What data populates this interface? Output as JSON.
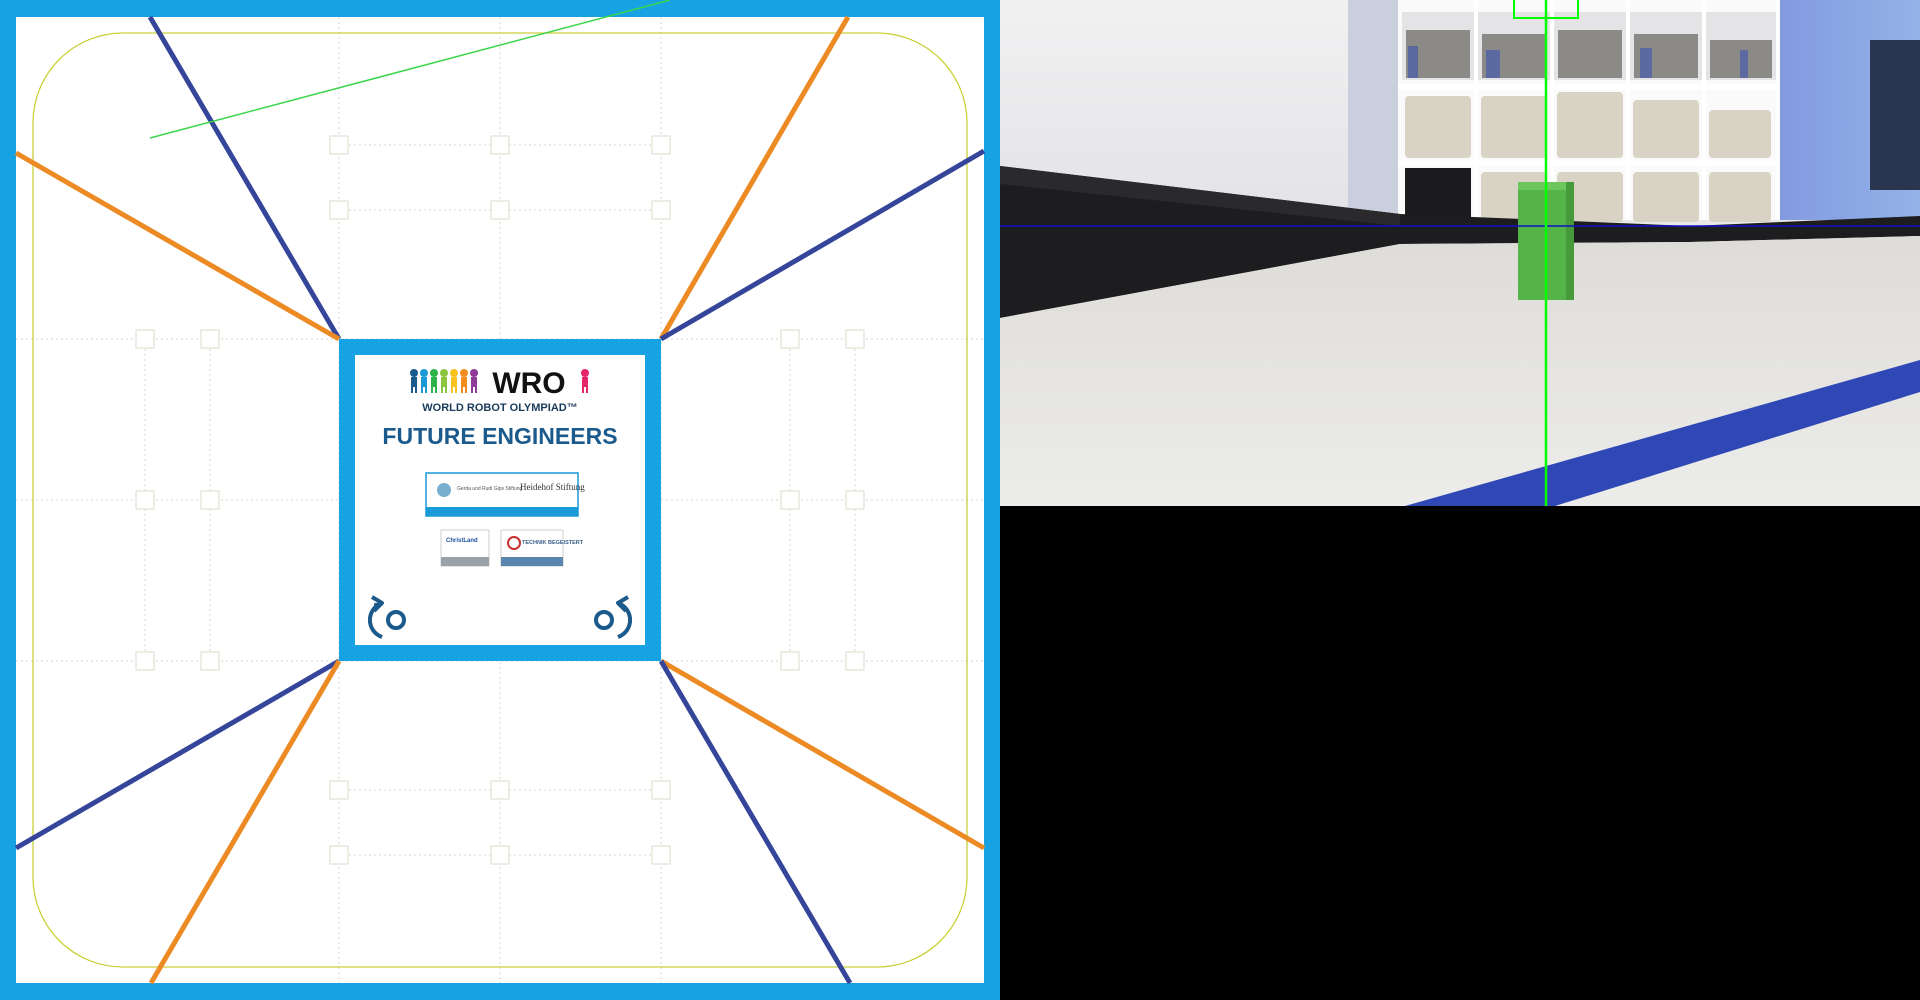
{
  "field": {
    "colors": {
      "border": "#17a3e3",
      "blue_line": "#34459a",
      "orange_line": "#ec8a24",
      "guide_yellow": "#c9d13a",
      "trajectory_green": "#3ad64a",
      "dotted_grid": "#cfd3d6",
      "logo_navy": "#1a5a8c"
    },
    "logo": {
      "brand": "WRO",
      "tagline": "WORLD ROBOT OLYMPIAD™",
      "category": "FUTURE ENGINEERS"
    },
    "sponsors": {
      "banner_left": "Gerda und Rudi Gips Stiftung",
      "banner_right": "Heidehof Stiftung",
      "small_left": "ChristLand",
      "small_right": "TECHNIK BEGEISTERT"
    },
    "direction_icons": [
      "rotate-counterclockwise-icon",
      "rotate-clockwise-icon"
    ]
  },
  "camera": {
    "colors": {
      "floor": "#e8e8e6",
      "wall": "#1d1d1f",
      "line": "#2f48b5",
      "pillar": "#55b447",
      "overlay_green": "#00ff00",
      "overlay_blue": "#1010c8"
    }
  }
}
